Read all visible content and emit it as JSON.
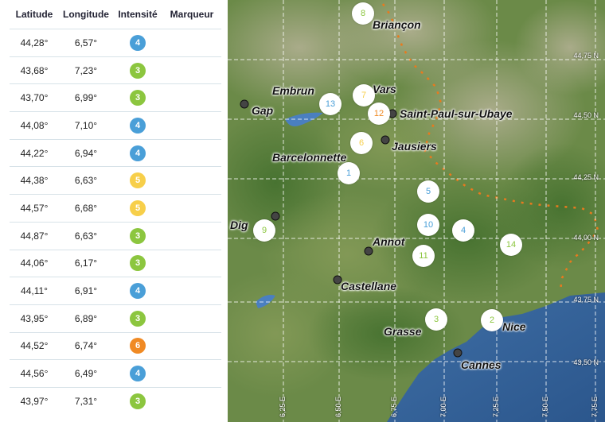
{
  "table": {
    "headers": {
      "lat": "Latitude",
      "lon": "Longitude",
      "intensity": "Intensité",
      "marker": "Marqueur"
    },
    "rows": [
      {
        "lat": "44,28°",
        "lon": "6,57°",
        "intensity": "4"
      },
      {
        "lat": "43,68°",
        "lon": "7,23°",
        "intensity": "3"
      },
      {
        "lat": "43,70°",
        "lon": "6,99°",
        "intensity": "3"
      },
      {
        "lat": "44,08°",
        "lon": "7,10°",
        "intensity": "4"
      },
      {
        "lat": "44,22°",
        "lon": "6,94°",
        "intensity": "4"
      },
      {
        "lat": "44,38°",
        "lon": "6,63°",
        "intensity": "5"
      },
      {
        "lat": "44,57°",
        "lon": "6,68°",
        "intensity": "5"
      },
      {
        "lat": "44,87°",
        "lon": "6,63°",
        "intensity": "3"
      },
      {
        "lat": "44,06°",
        "lon": "6,17°",
        "intensity": "3"
      },
      {
        "lat": "44,11°",
        "lon": "6,91°",
        "intensity": "4"
      },
      {
        "lat": "43,95°",
        "lon": "6,89°",
        "intensity": "3"
      },
      {
        "lat": "44,52°",
        "lon": "6,74°",
        "intensity": "6"
      },
      {
        "lat": "44,56°",
        "lon": "6,49°",
        "intensity": "4"
      },
      {
        "lat": "43,97°",
        "lon": "7,31°",
        "intensity": "3"
      }
    ]
  },
  "intensity_colors": {
    "3": "#8cc63f",
    "4": "#4a9fd8",
    "5": "#f7cf4a",
    "6": "#f08a24"
  },
  "map": {
    "cities": [
      {
        "name": "Briançon"
      },
      {
        "name": "Embrun"
      },
      {
        "name": "Vars"
      },
      {
        "name": "Gap"
      },
      {
        "name": "Saint-Paul-sur-Ubaye"
      },
      {
        "name": "Jausiers"
      },
      {
        "name": "Barcelonnette"
      },
      {
        "name": "Dig"
      },
      {
        "name": "Annot"
      },
      {
        "name": "Castellane"
      },
      {
        "name": "Grasse"
      },
      {
        "name": "Nice"
      },
      {
        "name": "Cannes"
      }
    ],
    "markers": [
      "1",
      "2",
      "3",
      "4",
      "5",
      "6",
      "7",
      "8",
      "9",
      "10",
      "11",
      "12",
      "13",
      "14"
    ],
    "lat_labels": [
      "44,75 N",
      "44,50 N",
      "44,25 N",
      "44,00 N",
      "43,75 N",
      "43,50 N"
    ],
    "lon_labels": [
      "6,25 E",
      "6,50 E",
      "6,75 E",
      "7,00 E",
      "7,25 E",
      "7,50 E",
      "7,75 E"
    ]
  }
}
